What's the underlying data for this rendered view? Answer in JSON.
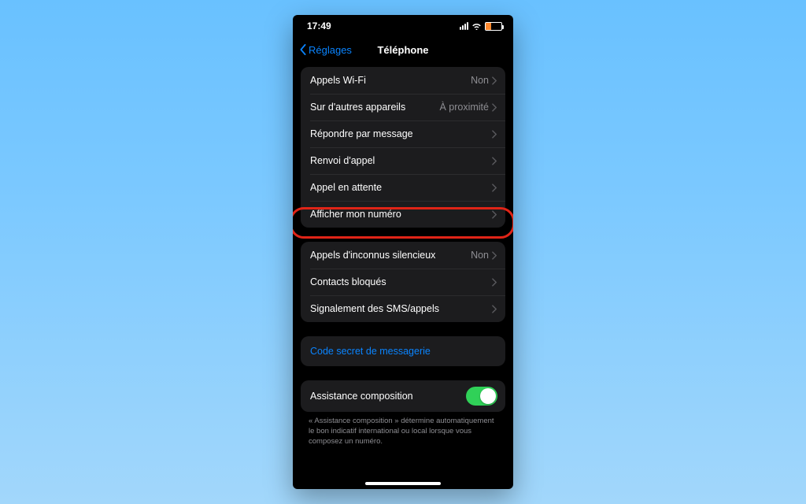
{
  "status": {
    "time": "17:49"
  },
  "nav": {
    "back": "Réglages",
    "title": "Téléphone"
  },
  "groups": {
    "g1": [
      {
        "label": "Appels Wi-Fi",
        "value": "Non"
      },
      {
        "label": "Sur d'autres appareils",
        "value": "À proximité"
      },
      {
        "label": "Répondre par message",
        "value": ""
      },
      {
        "label": "Renvoi d'appel",
        "value": ""
      },
      {
        "label": "Appel en attente",
        "value": ""
      },
      {
        "label": "Afficher mon numéro",
        "value": ""
      }
    ],
    "g2": [
      {
        "label": "Appels d'inconnus silencieux",
        "value": "Non"
      },
      {
        "label": "Contacts bloqués",
        "value": ""
      },
      {
        "label": "Signalement des SMS/appels",
        "value": ""
      }
    ],
    "g3": [
      {
        "label": "Code secret de messagerie"
      }
    ],
    "g4": [
      {
        "label": "Assistance composition"
      }
    ]
  },
  "footer": "« Assistance composition » détermine automatiquement le bon indicatif international ou local lorsque vous composez un numéro."
}
